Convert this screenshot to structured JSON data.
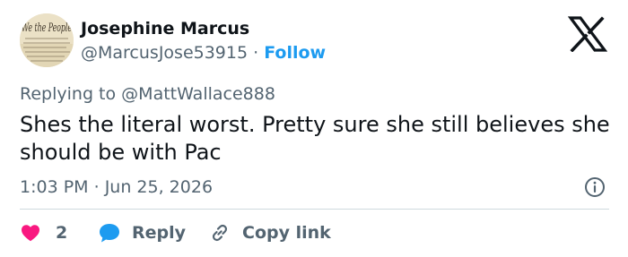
{
  "author": {
    "name": "Josephine Marcus",
    "handle": "@MarcusJose53915",
    "separator": "·",
    "follow_label": "Follow",
    "avatar_text": "We the People"
  },
  "reply_context": {
    "prefix": "Replying to",
    "target": "@MattWallace888"
  },
  "tweet": {
    "text": "Shes the literal worst. Pretty sure she still believes she should be with Pac",
    "time": "1:03 PM",
    "separator": "·",
    "date": "Jun 25, 2026"
  },
  "actions": {
    "like_count": "2",
    "reply_label": "Reply",
    "copy_label": "Copy link"
  },
  "colors": {
    "accent": "#1d9bf0",
    "heart": "#f91880",
    "reply_bubble": "#1d9bf0",
    "secondary_text": "#536471",
    "divider": "#cfd9de"
  },
  "icons": [
    "x-logo-icon",
    "info-icon",
    "heart-icon",
    "reply-bubble-icon",
    "link-icon"
  ]
}
